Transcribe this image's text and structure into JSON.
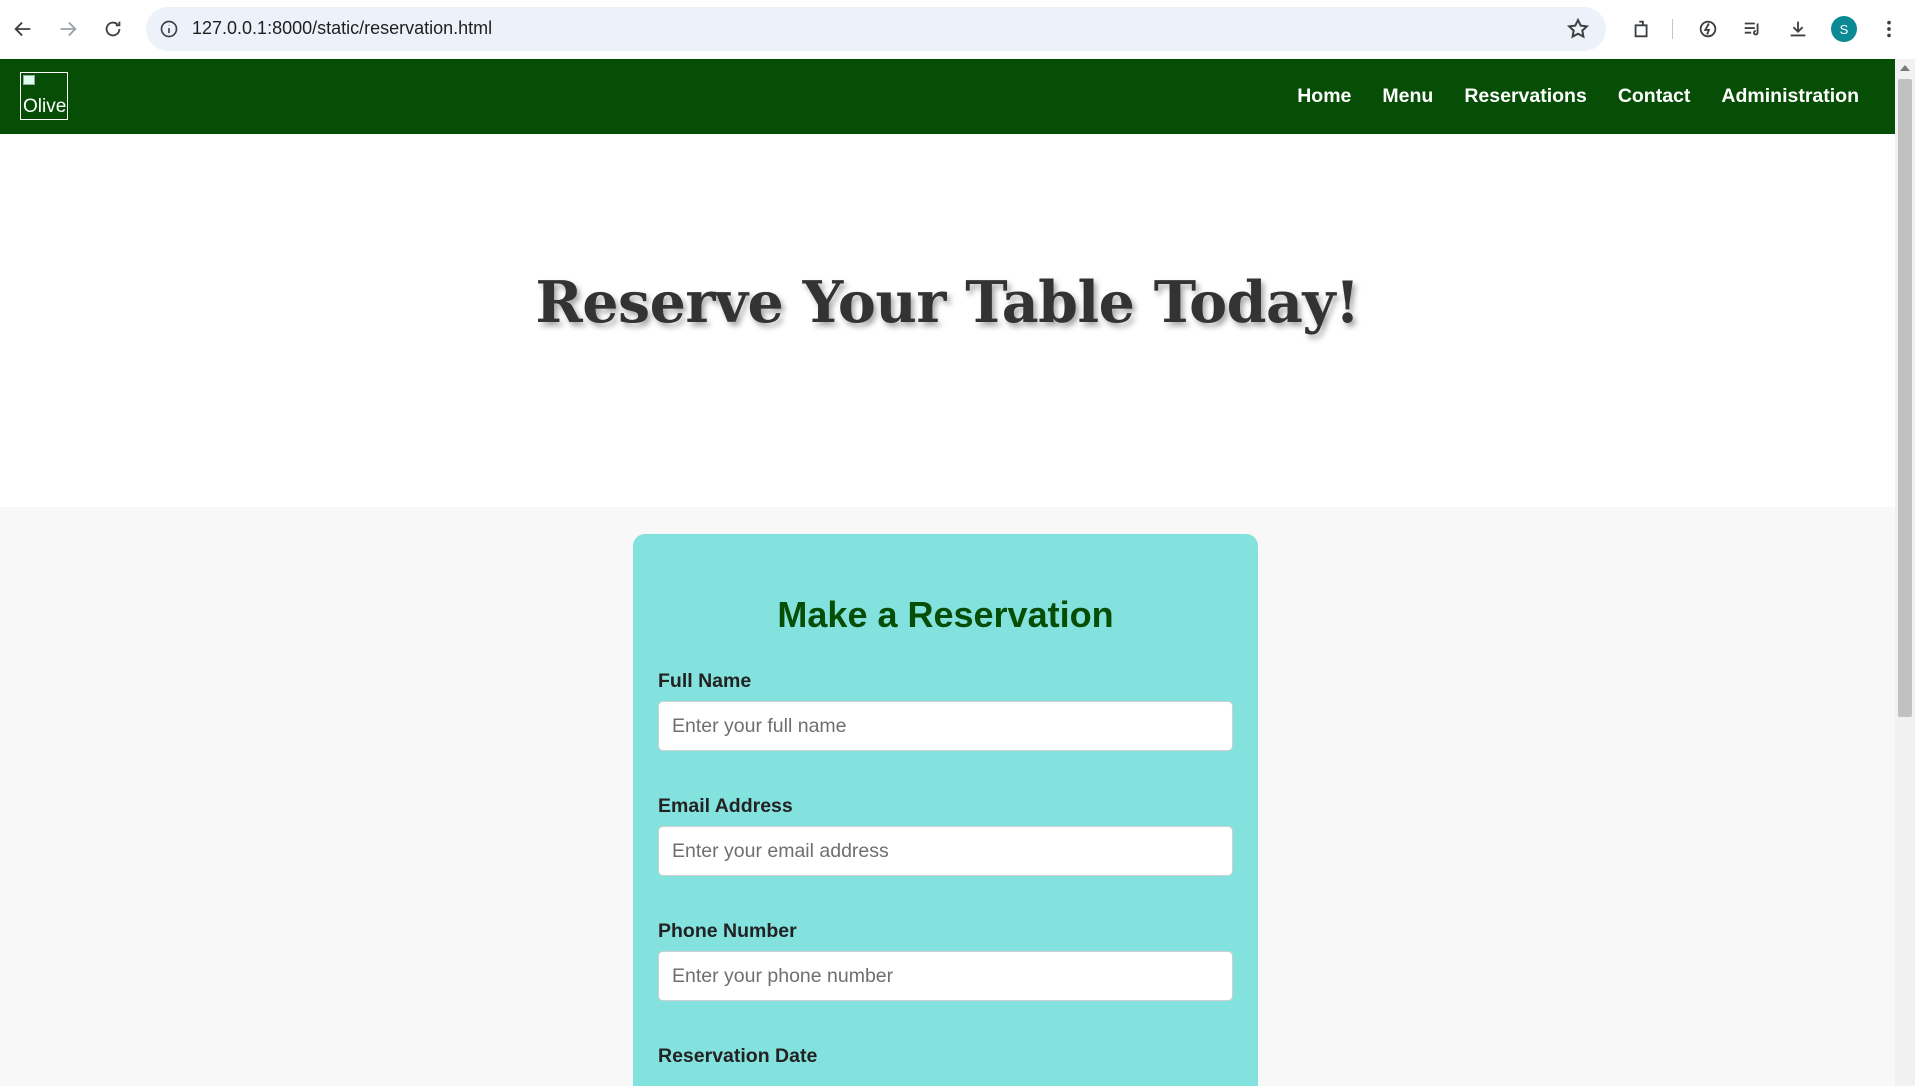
{
  "browser": {
    "url": "127.0.0.1:8000/static/reservation.html",
    "profile_initial": "S"
  },
  "site": {
    "logo_alt": "Olive",
    "nav": [
      "Home",
      "Menu",
      "Reservations",
      "Contact",
      "Administration"
    ]
  },
  "hero": {
    "title": "Reserve Your Table Today!"
  },
  "form": {
    "title": "Make a Reservation",
    "fields": [
      {
        "label": "Full Name",
        "placeholder": "Enter your full name"
      },
      {
        "label": "Email Address",
        "placeholder": "Enter your email address"
      },
      {
        "label": "Phone Number",
        "placeholder": "Enter your phone number"
      },
      {
        "label": "Reservation Date"
      }
    ]
  },
  "colors": {
    "header_bg": "#064d06",
    "card_bg": "#83e1de",
    "form_title": "#064d06"
  }
}
